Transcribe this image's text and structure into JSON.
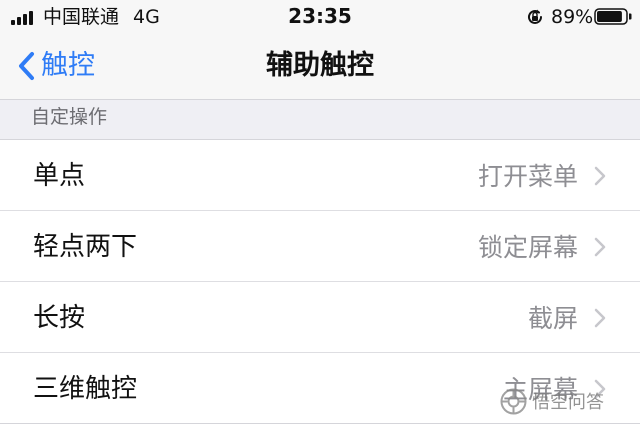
{
  "status_bar": {
    "carrier": "中国联通",
    "network": "4G",
    "time": "23:35",
    "battery_percent": "89%",
    "battery_level": 0.89
  },
  "nav": {
    "back_label": "触控",
    "title": "辅助触控"
  },
  "section": {
    "header": "自定操作"
  },
  "rows": [
    {
      "label": "单点",
      "value": "打开菜单"
    },
    {
      "label": "轻点两下",
      "value": "锁定屏幕"
    },
    {
      "label": "长按",
      "value": "截屏"
    },
    {
      "label": "三维触控",
      "value": "主屏幕"
    }
  ],
  "watermark": {
    "text": "悟空问答"
  },
  "icons": {
    "signal": "signal-bars-icon",
    "lock": "rotation-lock-icon",
    "battery": "battery-icon",
    "back": "chevron-left-icon",
    "disclosure": "chevron-right-icon"
  },
  "colors": {
    "accent": "#2f7cf6",
    "background": "#efeff4",
    "secondary_text": "#8e8e93"
  }
}
